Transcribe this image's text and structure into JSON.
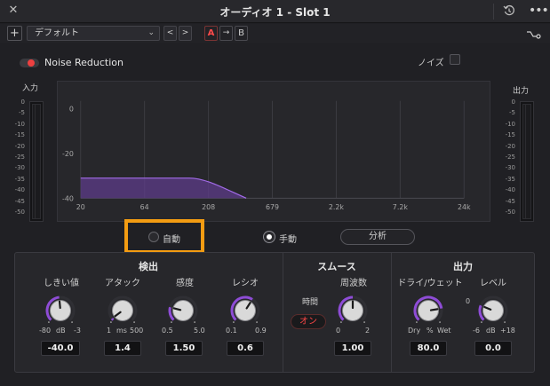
{
  "window": {
    "title": "オーディオ 1 - Slot 1"
  },
  "toolbar": {
    "add_label": "+",
    "preset_value": "デフォルト",
    "prev_label": "<",
    "next_label": ">",
    "a_label": "A",
    "arrow_label": "→",
    "b_label": "B"
  },
  "module": {
    "name": "Noise Reduction",
    "enabled": true,
    "noise_label": "ノイズ",
    "noise_checked": false
  },
  "meters": {
    "input_label": "入力",
    "output_label": "出力",
    "scale": [
      "0",
      "-5",
      "-10",
      "-15",
      "-20",
      "-25",
      "-30",
      "-35",
      "-40",
      "-45",
      "-50"
    ]
  },
  "graph": {
    "y_ticks": [
      "0",
      "-20",
      "-40"
    ],
    "x_ticks": [
      "20",
      "64",
      "208",
      "679",
      "2.2k",
      "7.2k",
      "24k"
    ]
  },
  "mode": {
    "auto_label": "自動",
    "manual_label": "手動",
    "selected": "manual",
    "analyze_label": "分析"
  },
  "detect": {
    "title": "検出",
    "threshold": {
      "label": "しきい値",
      "min": "-80",
      "unit": "dB",
      "max": "-3",
      "value": "-40.0",
      "level": 0.48
    },
    "attack": {
      "label": "アタック",
      "min": "1",
      "unit": "ms",
      "max": "500",
      "value": "1.4",
      "level": 0.03
    },
    "sensitivity": {
      "label": "感度",
      "min": "0.5",
      "max": "5.0",
      "value": "1.50",
      "level": 0.22
    },
    "ratio": {
      "label": "レシオ",
      "min": "0.1",
      "max": "0.9",
      "value": "0.6",
      "level": 0.62
    }
  },
  "smooth": {
    "title": "スムース",
    "time_label": "時間",
    "time_on_label": "オン",
    "frequency": {
      "label": "周波数",
      "min": "0",
      "max": "2",
      "value": "1.00",
      "level": 0.5
    }
  },
  "output": {
    "title": "出力",
    "drywet": {
      "label": "ドライ/ウェット",
      "min": "Dry",
      "unit": "%",
      "max": "Wet",
      "value": "80.0",
      "level": 0.8
    },
    "level": {
      "label": "レベル",
      "zero_label": "0",
      "min": "-6",
      "unit": "dB",
      "max": "+18",
      "value": "0.0",
      "level": 0.25
    }
  },
  "colors": {
    "accent": "#8e4cd6",
    "active_red": "#ee4040",
    "highlight": "#f39c12"
  }
}
